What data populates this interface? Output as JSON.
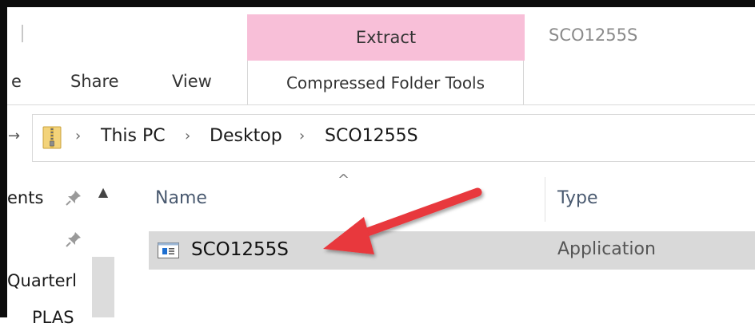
{
  "window": {
    "title": "SCO1255S"
  },
  "ribbon": {
    "contextual_tab": "Extract",
    "contextual_group": "Compressed Folder Tools",
    "tabs": [
      {
        "label": "e"
      },
      {
        "label": "Share"
      },
      {
        "label": "View"
      }
    ]
  },
  "address_bar": {
    "folder_icon": "zip-folder-icon",
    "breadcrumbs": [
      "This PC",
      "Desktop",
      "SCO1255S"
    ],
    "separator": "›"
  },
  "nav_pane": {
    "items": [
      {
        "label": "ents",
        "pinned": true
      },
      {
        "label": "",
        "pinned": true
      },
      {
        "label": "Quarterl",
        "pinned": false
      },
      {
        "label": "PLAS",
        "pinned": false
      }
    ]
  },
  "file_list": {
    "columns": [
      {
        "label": "Name",
        "sorted": true
      },
      {
        "label": "Type"
      }
    ],
    "rows": [
      {
        "name": "SCO1255S",
        "type": "Application",
        "icon": "application-icon",
        "selected": true
      }
    ]
  },
  "colors": {
    "contextual_tab": "#f8bfd8",
    "selection": "#d9d9d9",
    "annotation_arrow": "#e8373c"
  }
}
